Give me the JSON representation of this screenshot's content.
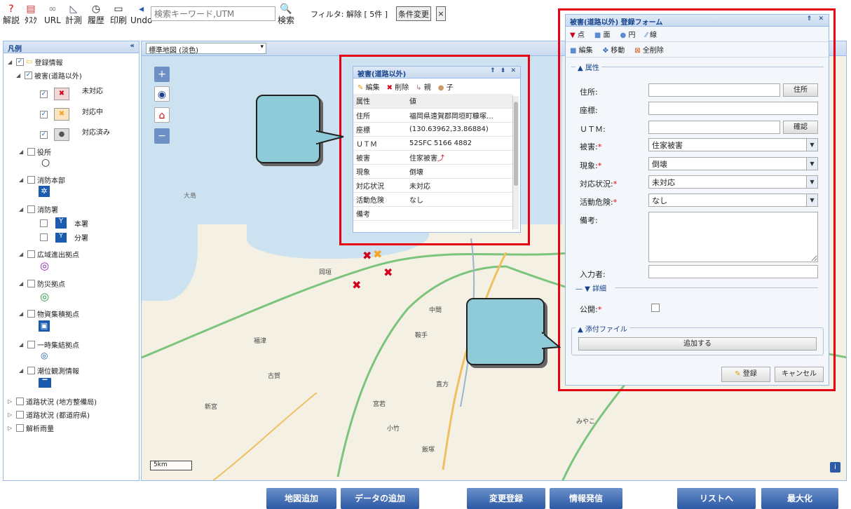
{
  "toolbar": {
    "items": [
      {
        "label": "解説",
        "icon": "?",
        "color": "#d00"
      },
      {
        "label": "ﾀｽｸ",
        "icon": "▤",
        "color": "#c33"
      },
      {
        "label": "URL",
        "icon": "🔗",
        "color": "#888"
      },
      {
        "label": "計測",
        "icon": "◺",
        "color": "#557"
      },
      {
        "label": "履歴",
        "icon": "◷",
        "color": "#333"
      },
      {
        "label": "印刷",
        "icon": "▭",
        "color": "#333"
      },
      {
        "label": "Undo",
        "icon": "◂",
        "color": "#2a5db0"
      }
    ],
    "search_placeholder": "検索キーワード,UTM",
    "search_label": "検索",
    "filter_text": "フィルタ: 解除 [ 5件 ]",
    "condition_button": "条件変更",
    "close": "×"
  },
  "legend": {
    "title": "凡例",
    "collapse": "«",
    "items": [
      {
        "label": "登録情報"
      },
      {
        "label": "被害(道路以外)"
      },
      {
        "label": "未対応"
      },
      {
        "label": "対応中"
      },
      {
        "label": "対応済み"
      },
      {
        "label": "役所"
      },
      {
        "label": "消防本部"
      },
      {
        "label": "消防署"
      },
      {
        "label": "本署"
      },
      {
        "label": "分署"
      },
      {
        "label": "広域進出拠点"
      },
      {
        "label": "防災拠点"
      },
      {
        "label": "物資集積拠点"
      },
      {
        "label": "一時集結拠点"
      },
      {
        "label": "潮位観測情報"
      },
      {
        "label": "道路状況 (地方整備局)"
      },
      {
        "label": "道路状況 (都道府県)"
      },
      {
        "label": "解析雨量"
      }
    ]
  },
  "map": {
    "basemap": "標準地図 (淡色)",
    "scale": "5km",
    "zoom_in": "+",
    "zoom_out": "−",
    "labels": [
      "大島",
      "岡垣",
      "中間",
      "鞍手",
      "宮若",
      "福津",
      "新宮",
      "古賀",
      "小竹",
      "飯塚",
      "直方",
      "みやこ"
    ]
  },
  "popup": {
    "title": "被害(道路以外)",
    "actions": {
      "edit": "編集",
      "delete": "削除",
      "parent": "親",
      "child": "子"
    },
    "header": [
      "属性",
      "値"
    ],
    "rows": [
      [
        "住所",
        "福岡県遠賀郡岡垣町糠塚…"
      ],
      [
        "座標",
        "(130.63962,33.86884)"
      ],
      [
        "ＵＴＭ",
        "52SFC 5166 4882"
      ],
      [
        "被害",
        "住家被害"
      ],
      [
        "現象",
        "倒壊"
      ],
      [
        "対応状況",
        "未対応"
      ],
      [
        "活動危険",
        "なし"
      ],
      [
        "備考",
        ""
      ]
    ]
  },
  "form": {
    "title": "被害(道路以外) 登録フォーム",
    "draw_tools": [
      "点",
      "面",
      "円",
      "線"
    ],
    "edit_tools": [
      "編集",
      "移動",
      "全削除"
    ],
    "section_attr": "属性",
    "fields": {
      "address": "住所:",
      "coords": "座標:",
      "utm": "ＵＴＭ:",
      "damage": "被害:",
      "phenomenon": "現象:",
      "status": "対応状況:",
      "danger": "活動危険:",
      "note": "備考:",
      "author": "入力者:",
      "public": "公開:"
    },
    "values": {
      "damage": "住家被害",
      "phenomenon": "倒壊",
      "status": "未対応",
      "danger": "なし"
    },
    "address_btn": "住所",
    "confirm_btn": "確認",
    "detail": "詳細",
    "attach": "添付ファイル",
    "add_btn": "追加する",
    "register": "登録",
    "cancel": "キャンセル"
  },
  "bottom": {
    "buttons": [
      "地図追加",
      "データの追加",
      "変更登録",
      "情報発信",
      "リストへ",
      "最大化"
    ]
  },
  "colors": {
    "accent": "#2d5aa6",
    "highlight": "#e60012",
    "unhandled": "#d0021b",
    "inprogress": "#f5a623"
  }
}
